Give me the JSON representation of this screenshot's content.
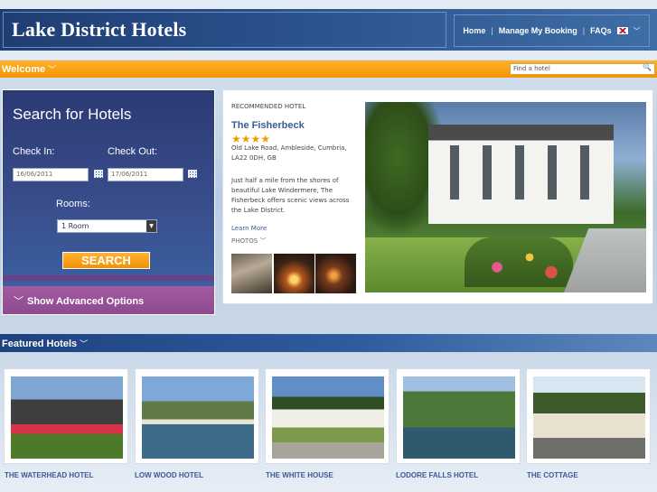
{
  "header": {
    "site_title": "Lake District Hotels",
    "nav": [
      {
        "label": "Home"
      },
      {
        "label": "Manage My Booking"
      },
      {
        "label": "FAQs"
      }
    ],
    "language_icon": "uk-flag-icon"
  },
  "welcome": {
    "label": "Welcome",
    "find_placeholder": "Find a hotel"
  },
  "search": {
    "title": "Search for Hotels",
    "check_in_label": "Check In:",
    "check_out_label": "Check Out:",
    "check_in_value": "16/06/2011",
    "check_out_value": "17/06/2011",
    "rooms_label": "Rooms:",
    "rooms_value": "1 Room",
    "search_button": "SEARCH",
    "advanced_label": "Show Advanced Options"
  },
  "recommended": {
    "header": "RECOMMENDED HOTEL",
    "name": "The Fisherbeck",
    "stars": "★★★★",
    "address": "Old Lake Road, Ambleside, Cumbria, LA22 0DH, GB",
    "description": "Just half a mile from the shores of beautiful Lake Windermere, The Fisherbeck offers scenic views across the Lake District.",
    "learn_more": "Learn More",
    "photos_label": "PHOTOS"
  },
  "featured": {
    "label": "Featured Hotels",
    "hotels": [
      {
        "name": "THE WATERHEAD HOTEL"
      },
      {
        "name": "LOW WOOD HOTEL"
      },
      {
        "name": "THE WHITE HOUSE"
      },
      {
        "name": "LODORE FALLS HOTEL"
      },
      {
        "name": "THE COTTAGE"
      }
    ]
  },
  "colors": {
    "accent_orange": "#f49500",
    "brand_blue": "#2a528e",
    "link_blue": "#3a5b96",
    "advanced_purple": "#9a55a0"
  }
}
